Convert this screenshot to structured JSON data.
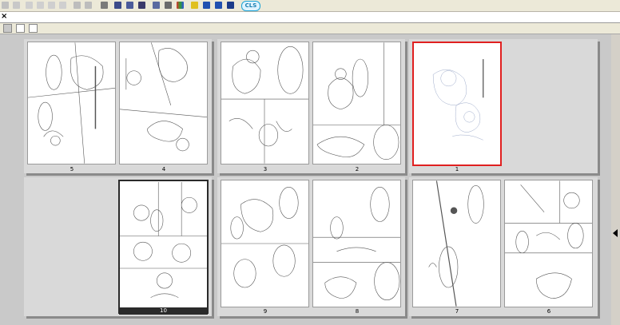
{
  "toolbar": {
    "icons": [
      "new-icon",
      "open-icon",
      "cut-icon",
      "copy-icon",
      "paste-icon",
      "delete-icon",
      "undo-icon",
      "redo-icon",
      "print-icon",
      "page-settings-icon",
      "page-list-icon",
      "spread-icon",
      "layer-icon",
      "tone-icon",
      "color-icon",
      "pen-icon",
      "window-a-icon",
      "window-b-icon",
      "play-icon"
    ],
    "cls_label": "CLS"
  },
  "tab": {
    "close_label": "×"
  },
  "pages": [
    {
      "number": "5"
    },
    {
      "number": "4"
    },
    {
      "number": "3"
    },
    {
      "number": "2"
    },
    {
      "number": "1"
    },
    {
      "number": "10"
    },
    {
      "number": "9"
    },
    {
      "number": "8"
    },
    {
      "number": "7"
    },
    {
      "number": "6"
    }
  ]
}
